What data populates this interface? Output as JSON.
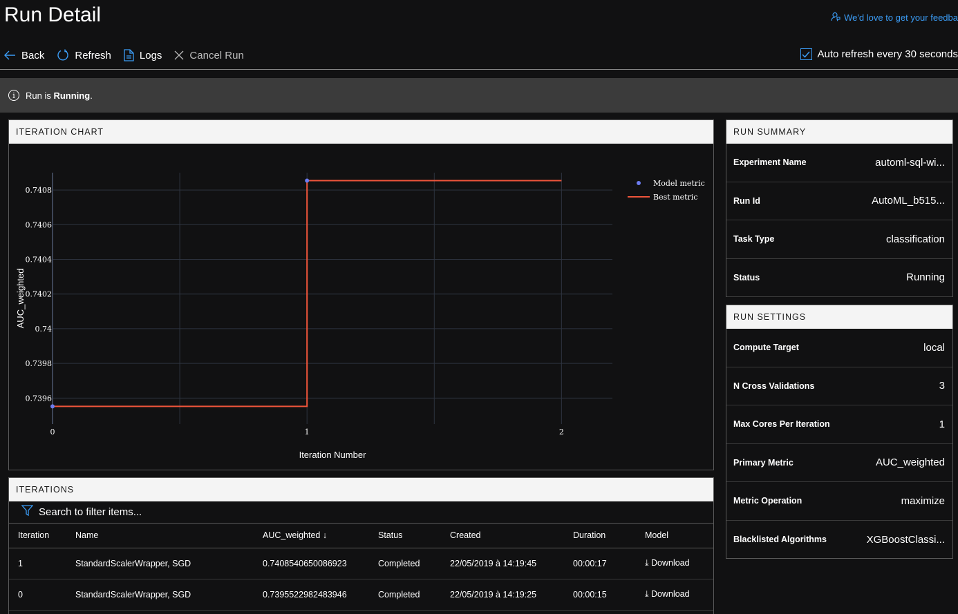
{
  "page": {
    "title": "Run Detail",
    "feedback": "We'd love to get your feedba"
  },
  "toolbar": {
    "back": "Back",
    "refresh": "Refresh",
    "logs": "Logs",
    "cancel": "Cancel Run",
    "auto_refresh": "Auto refresh every 30 seconds"
  },
  "status": {
    "prefix": "Run is ",
    "state": "Running",
    "suffix": "."
  },
  "iteration_chart": {
    "header": "ITERATION CHART"
  },
  "chart_data": {
    "type": "line",
    "xlabel": "Iteration Number",
    "ylabel": "AUC_weighted",
    "x_ticks": [
      "0",
      "1",
      "2"
    ],
    "y_ticks": [
      "0.7396",
      "0.7398",
      "0.74",
      "0.7402",
      "0.7404",
      "0.7406",
      "0.7408"
    ],
    "xlim": [
      0,
      2.2
    ],
    "ylim": [
      0.73945,
      0.7409
    ],
    "grid": true,
    "legend": "top-right",
    "series": [
      {
        "name": "Model metric",
        "kind": "scatter",
        "color": "#6c7cf0",
        "x": [
          0,
          1
        ],
        "y": [
          0.7395522982483946,
          0.7408540650086923
        ]
      },
      {
        "name": "Best metric",
        "kind": "step",
        "color": "#ef553b",
        "x": [
          0,
          1,
          2
        ],
        "y": [
          0.7395522982483946,
          0.7408540650086923,
          0.7408540650086923
        ]
      }
    ]
  },
  "iterations": {
    "header": "ITERATIONS",
    "filter_placeholder": "Search to filter items...",
    "columns": [
      "Iteration",
      "Name",
      "AUC_weighted",
      "Status",
      "Created",
      "Duration",
      "Model"
    ],
    "sort_indicator": "↓",
    "rows": [
      {
        "iteration": "1",
        "name": "StandardScalerWrapper, SGD",
        "auc": "0.7408540650086923",
        "status": "Completed",
        "created": "22/05/2019 à 14:19:45",
        "duration": "00:00:17",
        "model": "Download"
      },
      {
        "iteration": "0",
        "name": "StandardScalerWrapper, SGD",
        "auc": "0.7395522982483946",
        "status": "Completed",
        "created": "22/05/2019 à 14:19:25",
        "duration": "00:00:15",
        "model": "Download"
      }
    ]
  },
  "run_summary": {
    "header": "RUN SUMMARY",
    "items": [
      {
        "key": "Experiment Name",
        "value": "automl-sql-wi..."
      },
      {
        "key": "Run Id",
        "value": "AutoML_b515..."
      },
      {
        "key": "Task Type",
        "value": "classification"
      },
      {
        "key": "Status",
        "value": "Running"
      }
    ]
  },
  "run_settings": {
    "header": "RUN SETTINGS",
    "items": [
      {
        "key": "Compute Target",
        "value": "local"
      },
      {
        "key": "N Cross Validations",
        "value": "3"
      },
      {
        "key": "Max Cores Per Iteration",
        "value": "1"
      },
      {
        "key": "Primary Metric",
        "value": "AUC_weighted"
      },
      {
        "key": "Metric Operation",
        "value": "maximize"
      },
      {
        "key": "Blacklisted Algorithms",
        "value": "XGBoostClassi..."
      }
    ]
  },
  "colors": {
    "accent": "#3b9cf5",
    "status_bar": "#3b3b3b",
    "best_line": "#ef553b",
    "model_point": "#6c7cf0"
  }
}
